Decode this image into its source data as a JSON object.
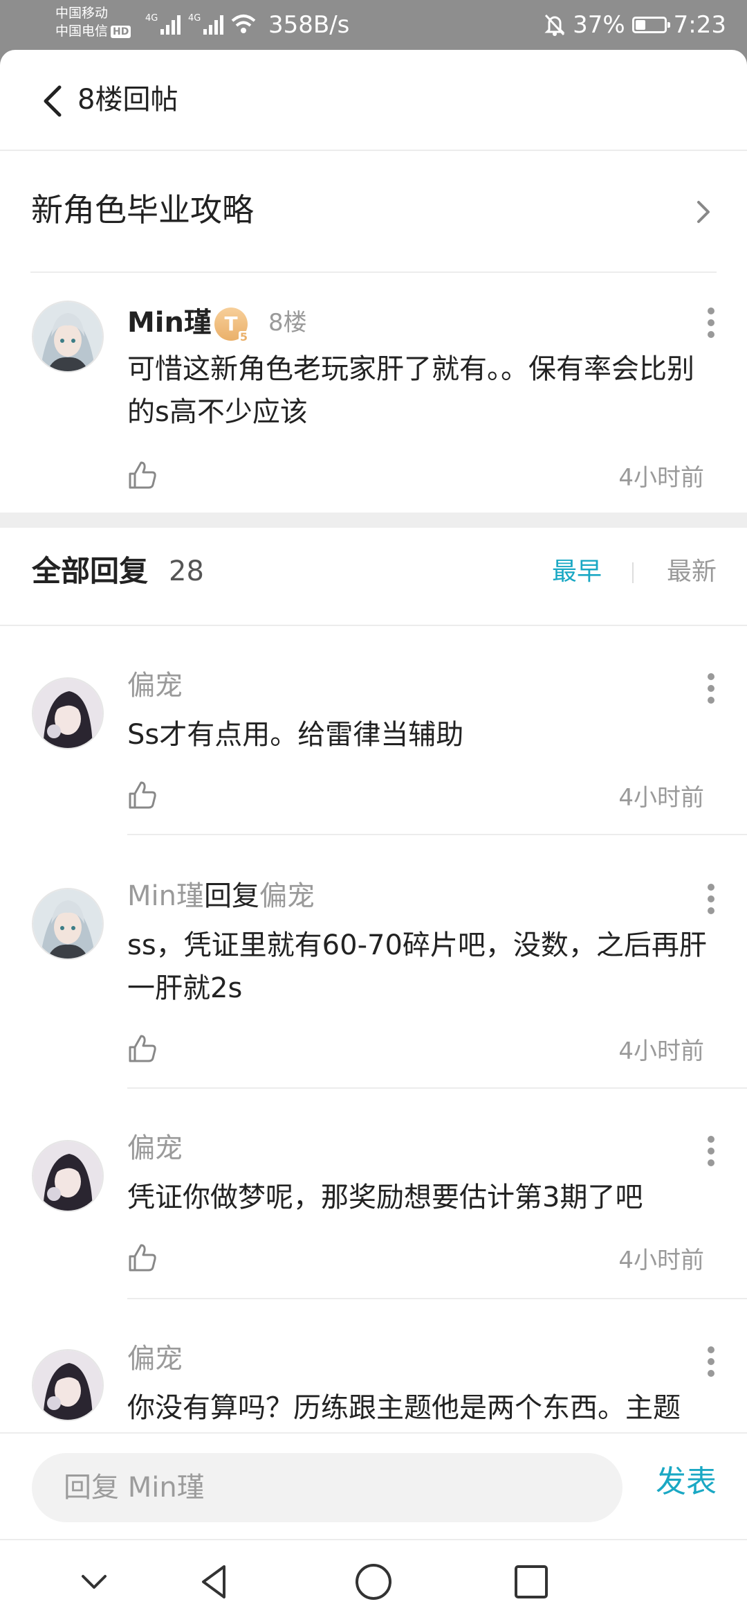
{
  "status_bar": {
    "carrier1": "中国移动",
    "carrier2": "中国电信",
    "hd_badge": "HD",
    "signal1_label": "4G",
    "signal2_label": "4G",
    "net_speed": "358B/s",
    "battery": "37%",
    "battery_level": 0.37,
    "time": "7:23"
  },
  "header": {
    "title": "8楼回帖"
  },
  "thread": {
    "title": "新角色毕业攻略"
  },
  "post": {
    "author": "Min瑾",
    "level_badge": "T",
    "level_number": "5",
    "floor": "8楼",
    "content": "可惜这新角色老玩家肝了就有。。保有率会比别的s高不少应该",
    "time": "4小时前"
  },
  "replies_header": {
    "label": "全部回复",
    "count": "28",
    "sort_earliest": "最早",
    "sort_newest": "最新"
  },
  "replies": [
    {
      "author": "偏宠",
      "reply_word": "",
      "reply_to": "",
      "content": "Ss才有点用。给雷律当辅助",
      "time": "4小时前"
    },
    {
      "author": "Min瑾",
      "reply_word": "回复",
      "reply_to": "偏宠",
      "content": "ss，凭证里就有60-70碎片吧，没数，之后再肝一肝就2s",
      "time": "4小时前"
    },
    {
      "author": "偏宠",
      "reply_word": "",
      "reply_to": "",
      "content": "凭证你做梦呢，那奖励想要估计第3期了吧",
      "time": "4小时前"
    },
    {
      "author": "偏宠",
      "reply_word": "",
      "reply_to": "",
      "content": "你没有算吗？历练跟主题他是两个东西。主题",
      "time": ""
    }
  ],
  "input": {
    "placeholder": "回复 Min瑾",
    "send_label": "发表"
  },
  "colors": {
    "accent": "#1aa8c4",
    "muted": "#9a9a9a",
    "status_bg": "#8e8e8e"
  }
}
